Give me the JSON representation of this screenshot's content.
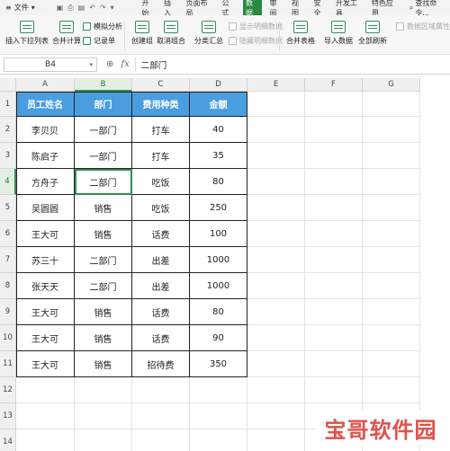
{
  "menubar": {
    "file_label": "文件",
    "tabs": [
      {
        "label": "开始",
        "active": false
      },
      {
        "label": "插入",
        "active": false
      },
      {
        "label": "页面布局",
        "active": false
      },
      {
        "label": "公式",
        "active": false
      },
      {
        "label": "数据",
        "active": true
      },
      {
        "label": "审阅",
        "active": false
      },
      {
        "label": "视图",
        "active": false
      },
      {
        "label": "安全",
        "active": false
      },
      {
        "label": "开发工具",
        "active": false
      },
      {
        "label": "特色应用",
        "active": false
      }
    ],
    "search_label": "查找命令..."
  },
  "ribbon": {
    "insert_dropdown": "插入下拉列表",
    "merge_calc": "合并计算",
    "simulate": "模拟分析",
    "record_form": "记录单",
    "create_group": "创建组",
    "ungroup": "取消组合",
    "subtotal": "分类汇总",
    "show_detail": "显示明细数据",
    "hide_detail": "隐藏明细数据",
    "merge_sheets": "合并表格",
    "import_data": "导入数据",
    "refresh_all": "全部刷新",
    "data_region": "数据区域属性"
  },
  "formula_bar": {
    "name_box": "B4",
    "value": "二部门"
  },
  "columns": [
    "A",
    "B",
    "C",
    "D",
    "E",
    "F",
    "G"
  ],
  "rows": [
    "1",
    "2",
    "3",
    "4",
    "5",
    "6",
    "7",
    "8",
    "9",
    "10",
    "11",
    "12",
    "13",
    "14"
  ],
  "table": {
    "headers": [
      "员工姓名",
      "部门",
      "费用种类",
      "金额"
    ],
    "rows": [
      [
        "李贝贝",
        "一部门",
        "打车",
        "40"
      ],
      [
        "陈启子",
        "一部门",
        "打车",
        "35"
      ],
      [
        "方舟子",
        "二部门",
        "吃饭",
        "80"
      ],
      [
        "吴圆圆",
        "销售",
        "吃饭",
        "250"
      ],
      [
        "王大可",
        "销售",
        "话费",
        "100"
      ],
      [
        "苏三十",
        "二部门",
        "出差",
        "1000"
      ],
      [
        "张天天",
        "二部门",
        "出差",
        "1000"
      ],
      [
        "王大可",
        "销售",
        "话费",
        "80"
      ],
      [
        "王大可",
        "销售",
        "话费",
        "90"
      ],
      [
        "王大可",
        "销售",
        "招待费",
        "350"
      ]
    ]
  },
  "selection": {
    "column": "B",
    "row": "4"
  },
  "watermark": "宝哥软件园",
  "colors": {
    "header_fill": "#4a9ee0",
    "accent": "#2f8f56",
    "watermark": "#e0524c"
  }
}
